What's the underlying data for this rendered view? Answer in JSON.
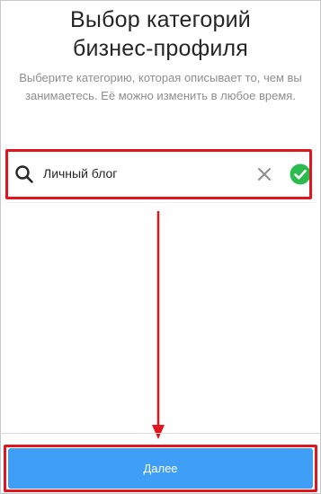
{
  "header": {
    "title_line1": "Выбор категорий",
    "title_line2": "бизнес-профиля",
    "subtitle": "Выберите категорию, которая описывает то, чем вы занимаетесь. Её можно изменить в любое время."
  },
  "search": {
    "value": "Личный блог",
    "search_icon": "search-icon",
    "clear_icon": "close-icon",
    "confirm_icon": "check-circle-icon"
  },
  "footer": {
    "next_label": "Далее"
  },
  "colors": {
    "accent": "#3f9ef5",
    "confirm": "#2bbb4f",
    "highlight": "#e0151e"
  }
}
